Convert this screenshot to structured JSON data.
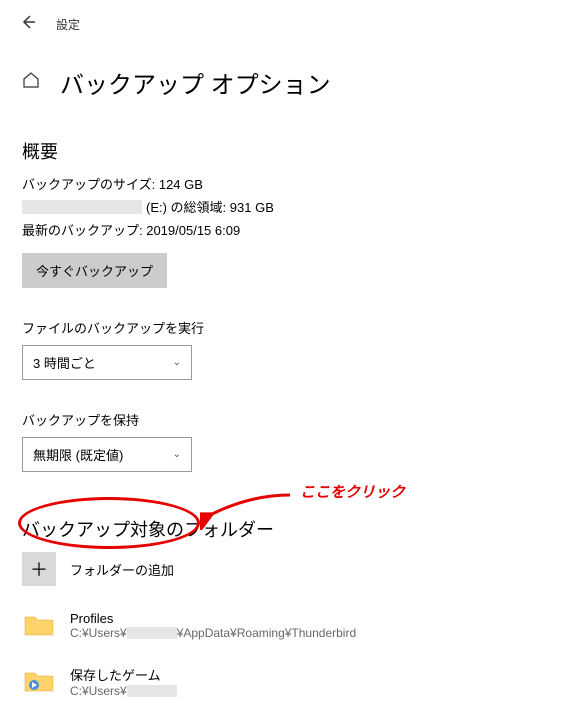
{
  "header": {
    "app_name": "設定"
  },
  "page": {
    "title": "バックアップ オプション"
  },
  "overview": {
    "heading": "概要",
    "size_label": "バックアップのサイズ: 124 GB",
    "drive_label_prefix": "",
    "drive_label_suffix": " (E:) の総領域: 931 GB",
    "last_backup_label": "最新のバックアップ: 2019/05/15 6:09",
    "backup_now_button": "今すぐバックアップ"
  },
  "frequency": {
    "label": "ファイルのバックアップを実行",
    "value": "3 時間ごと"
  },
  "retention": {
    "label": "バックアップを保持",
    "value": "無期限 (既定値)"
  },
  "folders": {
    "heading": "バックアップ対象のフォルダー",
    "add_label": "フォルダーの追加",
    "items": [
      {
        "name": "Profiles",
        "path_prefix": "C:¥Users¥",
        "path_suffix": "¥AppData¥Roaming¥Thunderbird"
      },
      {
        "name": "保存したゲーム",
        "path_prefix": "C:¥Users¥",
        "path_suffix": ""
      }
    ]
  },
  "annotation": {
    "text": "ここをクリック"
  }
}
